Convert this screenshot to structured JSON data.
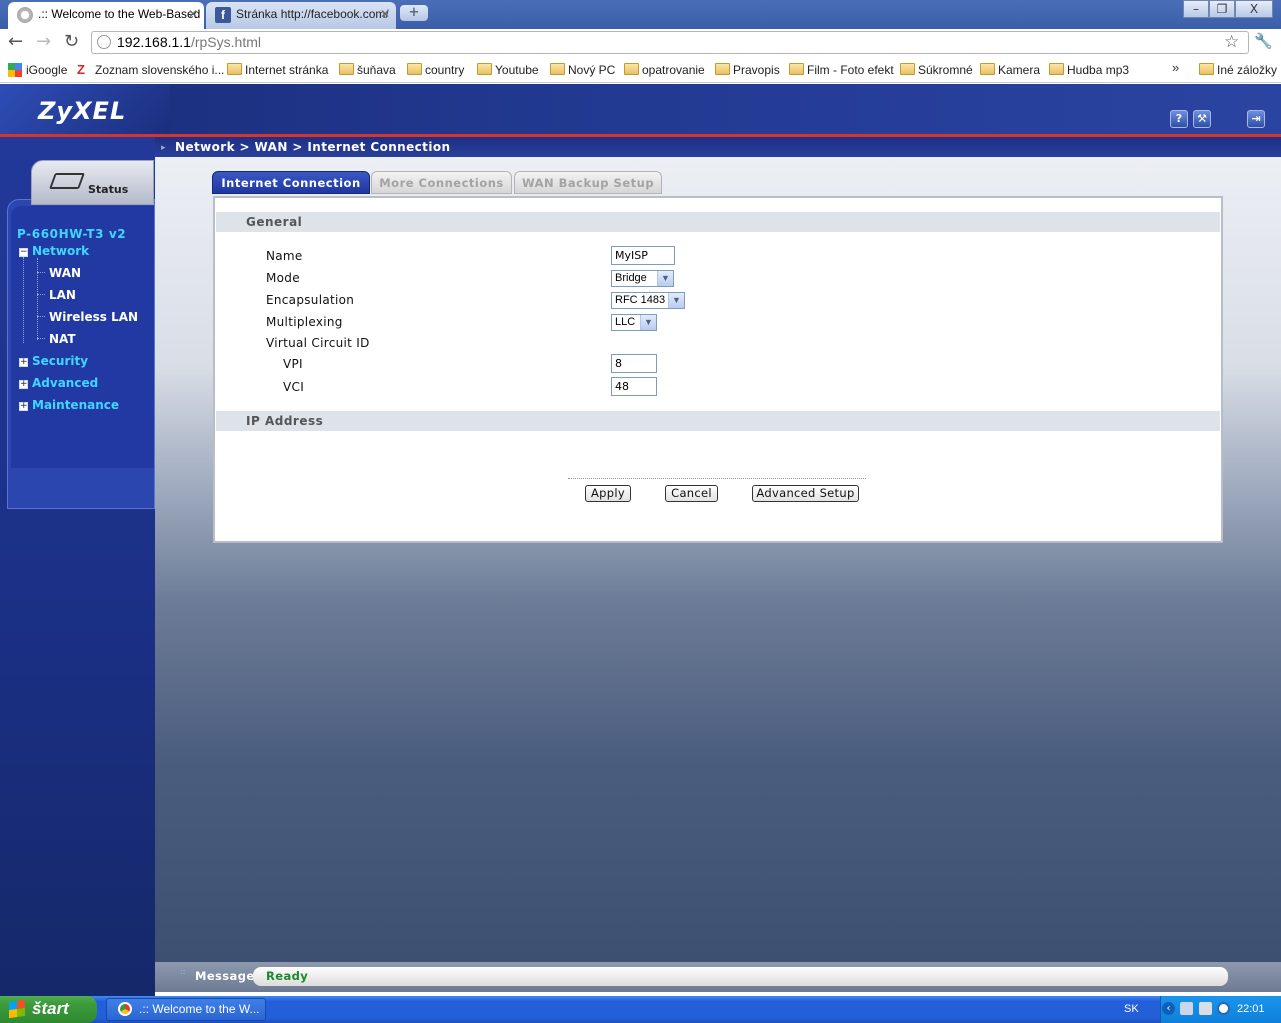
{
  "browser": {
    "tabs": [
      {
        "label": ".:: Welcome to the Web-Based",
        "active": true
      },
      {
        "label": "Stránka http://facebook.com/",
        "active": false
      }
    ],
    "new_tab": "+",
    "window_buttons": {
      "minimize": "–",
      "maximize": "❐",
      "close": "X"
    },
    "url_host": "192.168.1.1",
    "url_path": "/rpSys.html",
    "bookmarks": [
      "iGoogle",
      "Zoznam slovenského i...",
      "Internet stránka",
      "šuňava",
      "country",
      "Youtube",
      "Nový PC",
      "opatrovanie",
      "Pravopis",
      "Film - Foto efekt",
      "Súkromné",
      "Kamera",
      "Hudba mp3"
    ],
    "bookmarks_overflow": "»",
    "other_bookmarks": "Iné záložky"
  },
  "router": {
    "logo": "ZyXEL",
    "header_icons": [
      "?",
      "⚒",
      "⇥"
    ],
    "status_tab": "Status",
    "model": "P-660HW-T3 v2",
    "nav": {
      "network": "Network",
      "network_children": [
        "WAN",
        "LAN",
        "Wireless LAN",
        "NAT"
      ],
      "security": "Security",
      "advanced": "Advanced",
      "maintenance": "Maintenance",
      "expanded_marker": "−",
      "collapsed_marker": "+"
    },
    "breadcrumb": "Network > WAN > Internet Connection",
    "tabs": [
      "Internet Connection",
      "More Connections",
      "WAN Backup Setup"
    ],
    "sections": {
      "general": "General",
      "ip_address": "IP Address"
    },
    "fields": {
      "name_label": "Name",
      "name_value": "MyISP",
      "mode_label": "Mode",
      "mode_value": "Bridge",
      "encapsulation_label": "Encapsulation",
      "encapsulation_value": "RFC 1483",
      "multiplexing_label": "Multiplexing",
      "multiplexing_value": "LLC",
      "vci_group_label": "Virtual Circuit ID",
      "vpi_label": "VPI",
      "vpi_value": "8",
      "vci_label": "VCI",
      "vci_value": "48"
    },
    "buttons": {
      "apply": "Apply",
      "cancel": "Cancel",
      "advanced_setup": "Advanced Setup"
    },
    "message_label": "Message",
    "message_value": "Ready"
  },
  "taskbar": {
    "start": "štart",
    "task": ".:: Welcome to the W...",
    "lang": "SK",
    "clock": "22:01"
  }
}
